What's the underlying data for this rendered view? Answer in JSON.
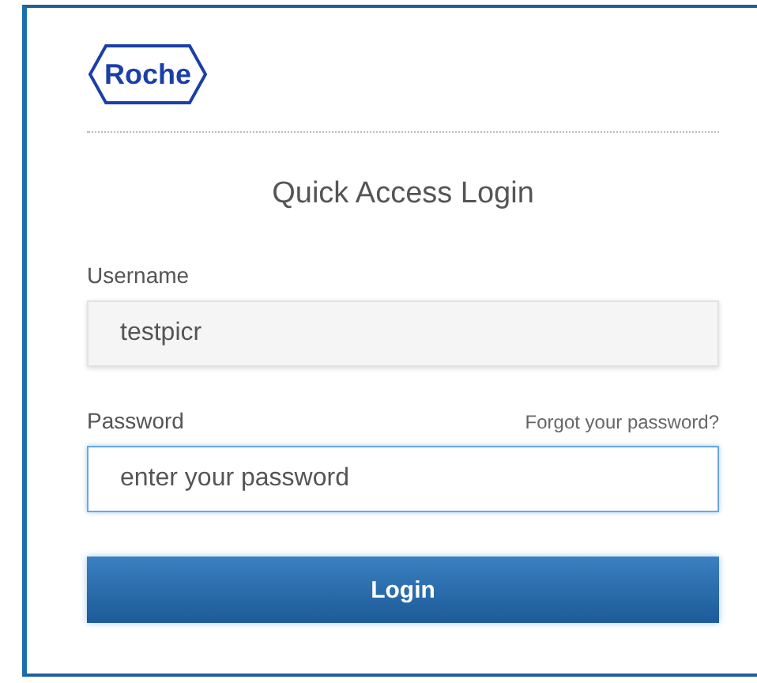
{
  "logo": {
    "text": "Roche"
  },
  "title": "Quick Access Login",
  "fields": [
    {
      "label": "Username",
      "value": "testpicr",
      "focused": false
    },
    {
      "label": "Password",
      "placeholder": "enter your password",
      "link": "Forgot your password?",
      "focused": true
    }
  ],
  "button": "Login"
}
